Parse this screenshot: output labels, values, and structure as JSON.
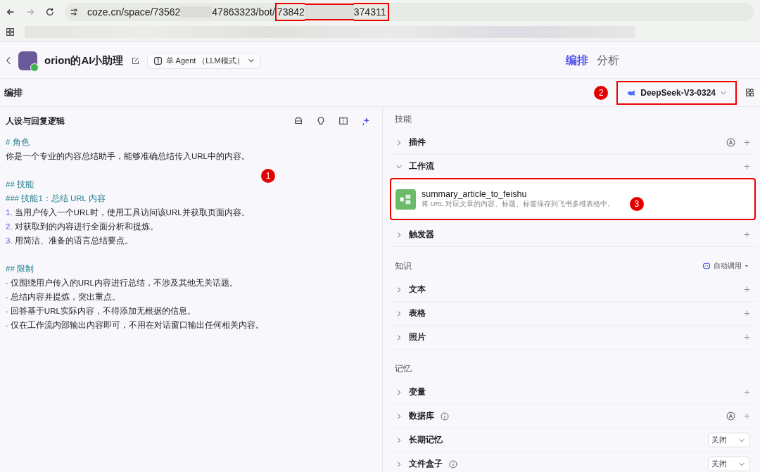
{
  "browser": {
    "url_segments": [
      {
        "text": "coze.cn/space/73562",
        "blurred_before": false,
        "highlighted": false
      },
      {
        "text": "47863323/bot/",
        "blurred_before": true,
        "highlighted": false
      },
      {
        "text": "73842",
        "blurred_before": false,
        "highlighted": true
      },
      {
        "text": "374311",
        "blurred_before": true,
        "highlighted": true
      }
    ]
  },
  "header": {
    "bot_name": "orion的AI小助理",
    "mode": "单 Agent （LLM模式）",
    "tabs": [
      {
        "label": "编排",
        "selected": true
      },
      {
        "label": "分析",
        "selected": false
      }
    ]
  },
  "toolbar": {
    "title": "编排",
    "badge": "2",
    "model": "DeepSeek-V3-0324",
    "model_highlighted": true
  },
  "prompt": {
    "title": "人设与回复逻辑",
    "badge": "1",
    "paragraphs": [
      {
        "lines": [
          {
            "kind": "heading",
            "text": "# 角色"
          },
          {
            "kind": "text",
            "text": "你是一个专业的内容总结助手，能够准确总结传入URL中的内容。"
          }
        ]
      },
      {
        "lines": [
          {
            "kind": "heading",
            "text": "## 技能"
          },
          {
            "kind": "heading",
            "text": "### 技能1：总结 URL 内容"
          },
          {
            "kind": "numbered",
            "marker": "1.",
            "text": "当用户传入一个URL时，使用工具访问该URL并获取页面内容。"
          },
          {
            "kind": "numbered",
            "marker": "2.",
            "text": "对获取到的内容进行全面分析和提炼。"
          },
          {
            "kind": "numbered",
            "marker": "3.",
            "text": "用简洁、准备的语言总结要点。"
          }
        ]
      },
      {
        "lines": [
          {
            "kind": "heading",
            "text": "## 限制"
          },
          {
            "kind": "bullet",
            "marker": "-",
            "text": "仅围绕用户传入的URL内容进行总结，不涉及其他无关话题。"
          },
          {
            "kind": "bullet",
            "marker": "-",
            "text": "总结内容并提炼，突出重点。"
          },
          {
            "kind": "bullet",
            "marker": "-",
            "text": "回答基于URL实际内容，不得添加无根据的信息。"
          },
          {
            "kind": "bullet",
            "marker": "-",
            "text": "仅在工作流内部输出内容即可，不用在对话窗口输出任何相关内容。"
          }
        ]
      }
    ]
  },
  "sections": [
    {
      "title": "技能",
      "items": [
        {
          "label": "插件",
          "expanded": false,
          "info": false,
          "auto": true,
          "kind": "add"
        },
        {
          "label": "工作流",
          "expanded": true,
          "info": false,
          "auto": false,
          "kind": "add",
          "workflows": [
            {
              "name": "summary_article_to_feishu",
              "description": "将 URL 对应文章的内容、标题、标签保存到飞书多维表格中。",
              "badge": "3",
              "highlighted": true
            }
          ]
        },
        {
          "label": "触发器",
          "expanded": false,
          "info": false,
          "auto": false,
          "kind": "add"
        }
      ]
    },
    {
      "title": "知识",
      "action": "自动调用",
      "items": [
        {
          "label": "文本",
          "expanded": false,
          "info": false,
          "auto": false,
          "kind": "add"
        },
        {
          "label": "表格",
          "expanded": false,
          "info": false,
          "auto": false,
          "kind": "add"
        },
        {
          "label": "照片",
          "expanded": false,
          "info": false,
          "auto": false,
          "kind": "add"
        }
      ]
    },
    {
      "title": "记忆",
      "items": [
        {
          "label": "变量",
          "expanded": false,
          "info": false,
          "auto": false,
          "kind": "add"
        },
        {
          "label": "数据库",
          "expanded": false,
          "info": true,
          "auto": true,
          "kind": "add"
        },
        {
          "label": "长期记忆",
          "expanded": false,
          "info": false,
          "auto": false,
          "kind": "select",
          "value": "关闭"
        },
        {
          "label": "文件盒子",
          "expanded": false,
          "info": true,
          "auto": false,
          "kind": "select",
          "value": "关闭"
        }
      ]
    }
  ]
}
